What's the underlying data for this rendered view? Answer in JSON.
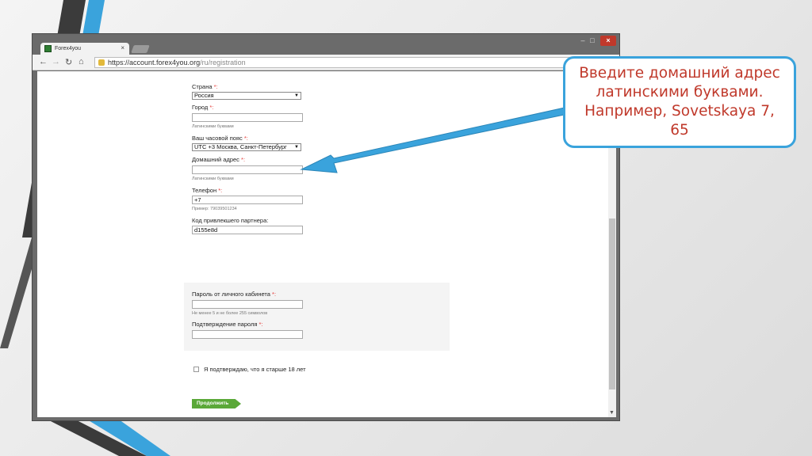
{
  "browser": {
    "tab_title": "Forex4you",
    "tab_close": "×",
    "url_host": "https://account.forex4you.org",
    "url_path": "/ru/registration",
    "min_label": "–",
    "max_label": "□",
    "close_label": "×"
  },
  "form": {
    "country": {
      "label": "Страна",
      "required": "*:",
      "value": "Россия"
    },
    "city": {
      "label": "Город",
      "required": "*:",
      "value": "",
      "hint": "Латинскими буквами"
    },
    "timezone": {
      "label": "Ваш часовой пояс",
      "required": "*:",
      "value": "UTC +3 Москва, Санкт-Петербург"
    },
    "address": {
      "label": "Домашний адрес",
      "required": "*:",
      "value": "",
      "hint": "Латинскими буквами"
    },
    "phone": {
      "label": "Телефон",
      "required": "*:",
      "value": "+7",
      "hint": "Пример: 79039501234"
    },
    "partner": {
      "label": "Код привлекшего партнера:",
      "value": "d155e8d"
    },
    "password": {
      "label": "Пароль от личного кабинета",
      "required": "*:",
      "value": "",
      "hint": "Не менее 5 и не более 255 символов"
    },
    "password_confirm": {
      "label": "Подтверждение пароля",
      "required": "*:",
      "value": ""
    },
    "age_checkbox_label": "Я подтверждаю, что я старше 18 лет",
    "continue_label": "Продолжить"
  },
  "callout": {
    "text": "Введите домашний адрес латинскими буквами. Например, Sovetskaya 7, 65"
  },
  "colors": {
    "accent_blue": "#3aa3dc",
    "callout_text": "#c0392b",
    "continue_green": "#5aa838",
    "required_red": "#e53935"
  }
}
